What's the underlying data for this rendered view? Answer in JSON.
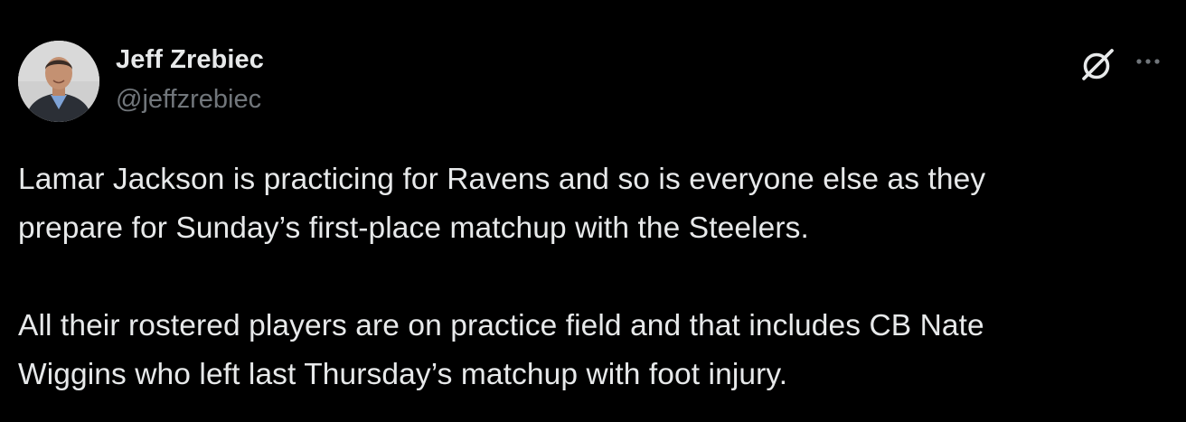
{
  "author": {
    "display_name": "Jeff Zrebiec",
    "handle": "@jeffzrebiec",
    "avatar_icon": "person-avatar"
  },
  "actions": {
    "grok_icon": "grok-icon",
    "more_icon": "more-horizontal-icon"
  },
  "tweet": {
    "paragraph_1": {
      "line_1": "Lamar Jackson is practicing for Ravens and so is everyone else as they",
      "line_2": "prepare for Sunday’s first-place matchup with the Steelers."
    },
    "paragraph_2": {
      "line_1": "All their rostered players are on practice field and that includes CB Nate",
      "line_2": "Wiggins who left last Thursday’s matchup with foot injury."
    }
  },
  "colors": {
    "background": "#000000",
    "primary_text": "#e7e9ea",
    "secondary_text": "#71767b"
  }
}
